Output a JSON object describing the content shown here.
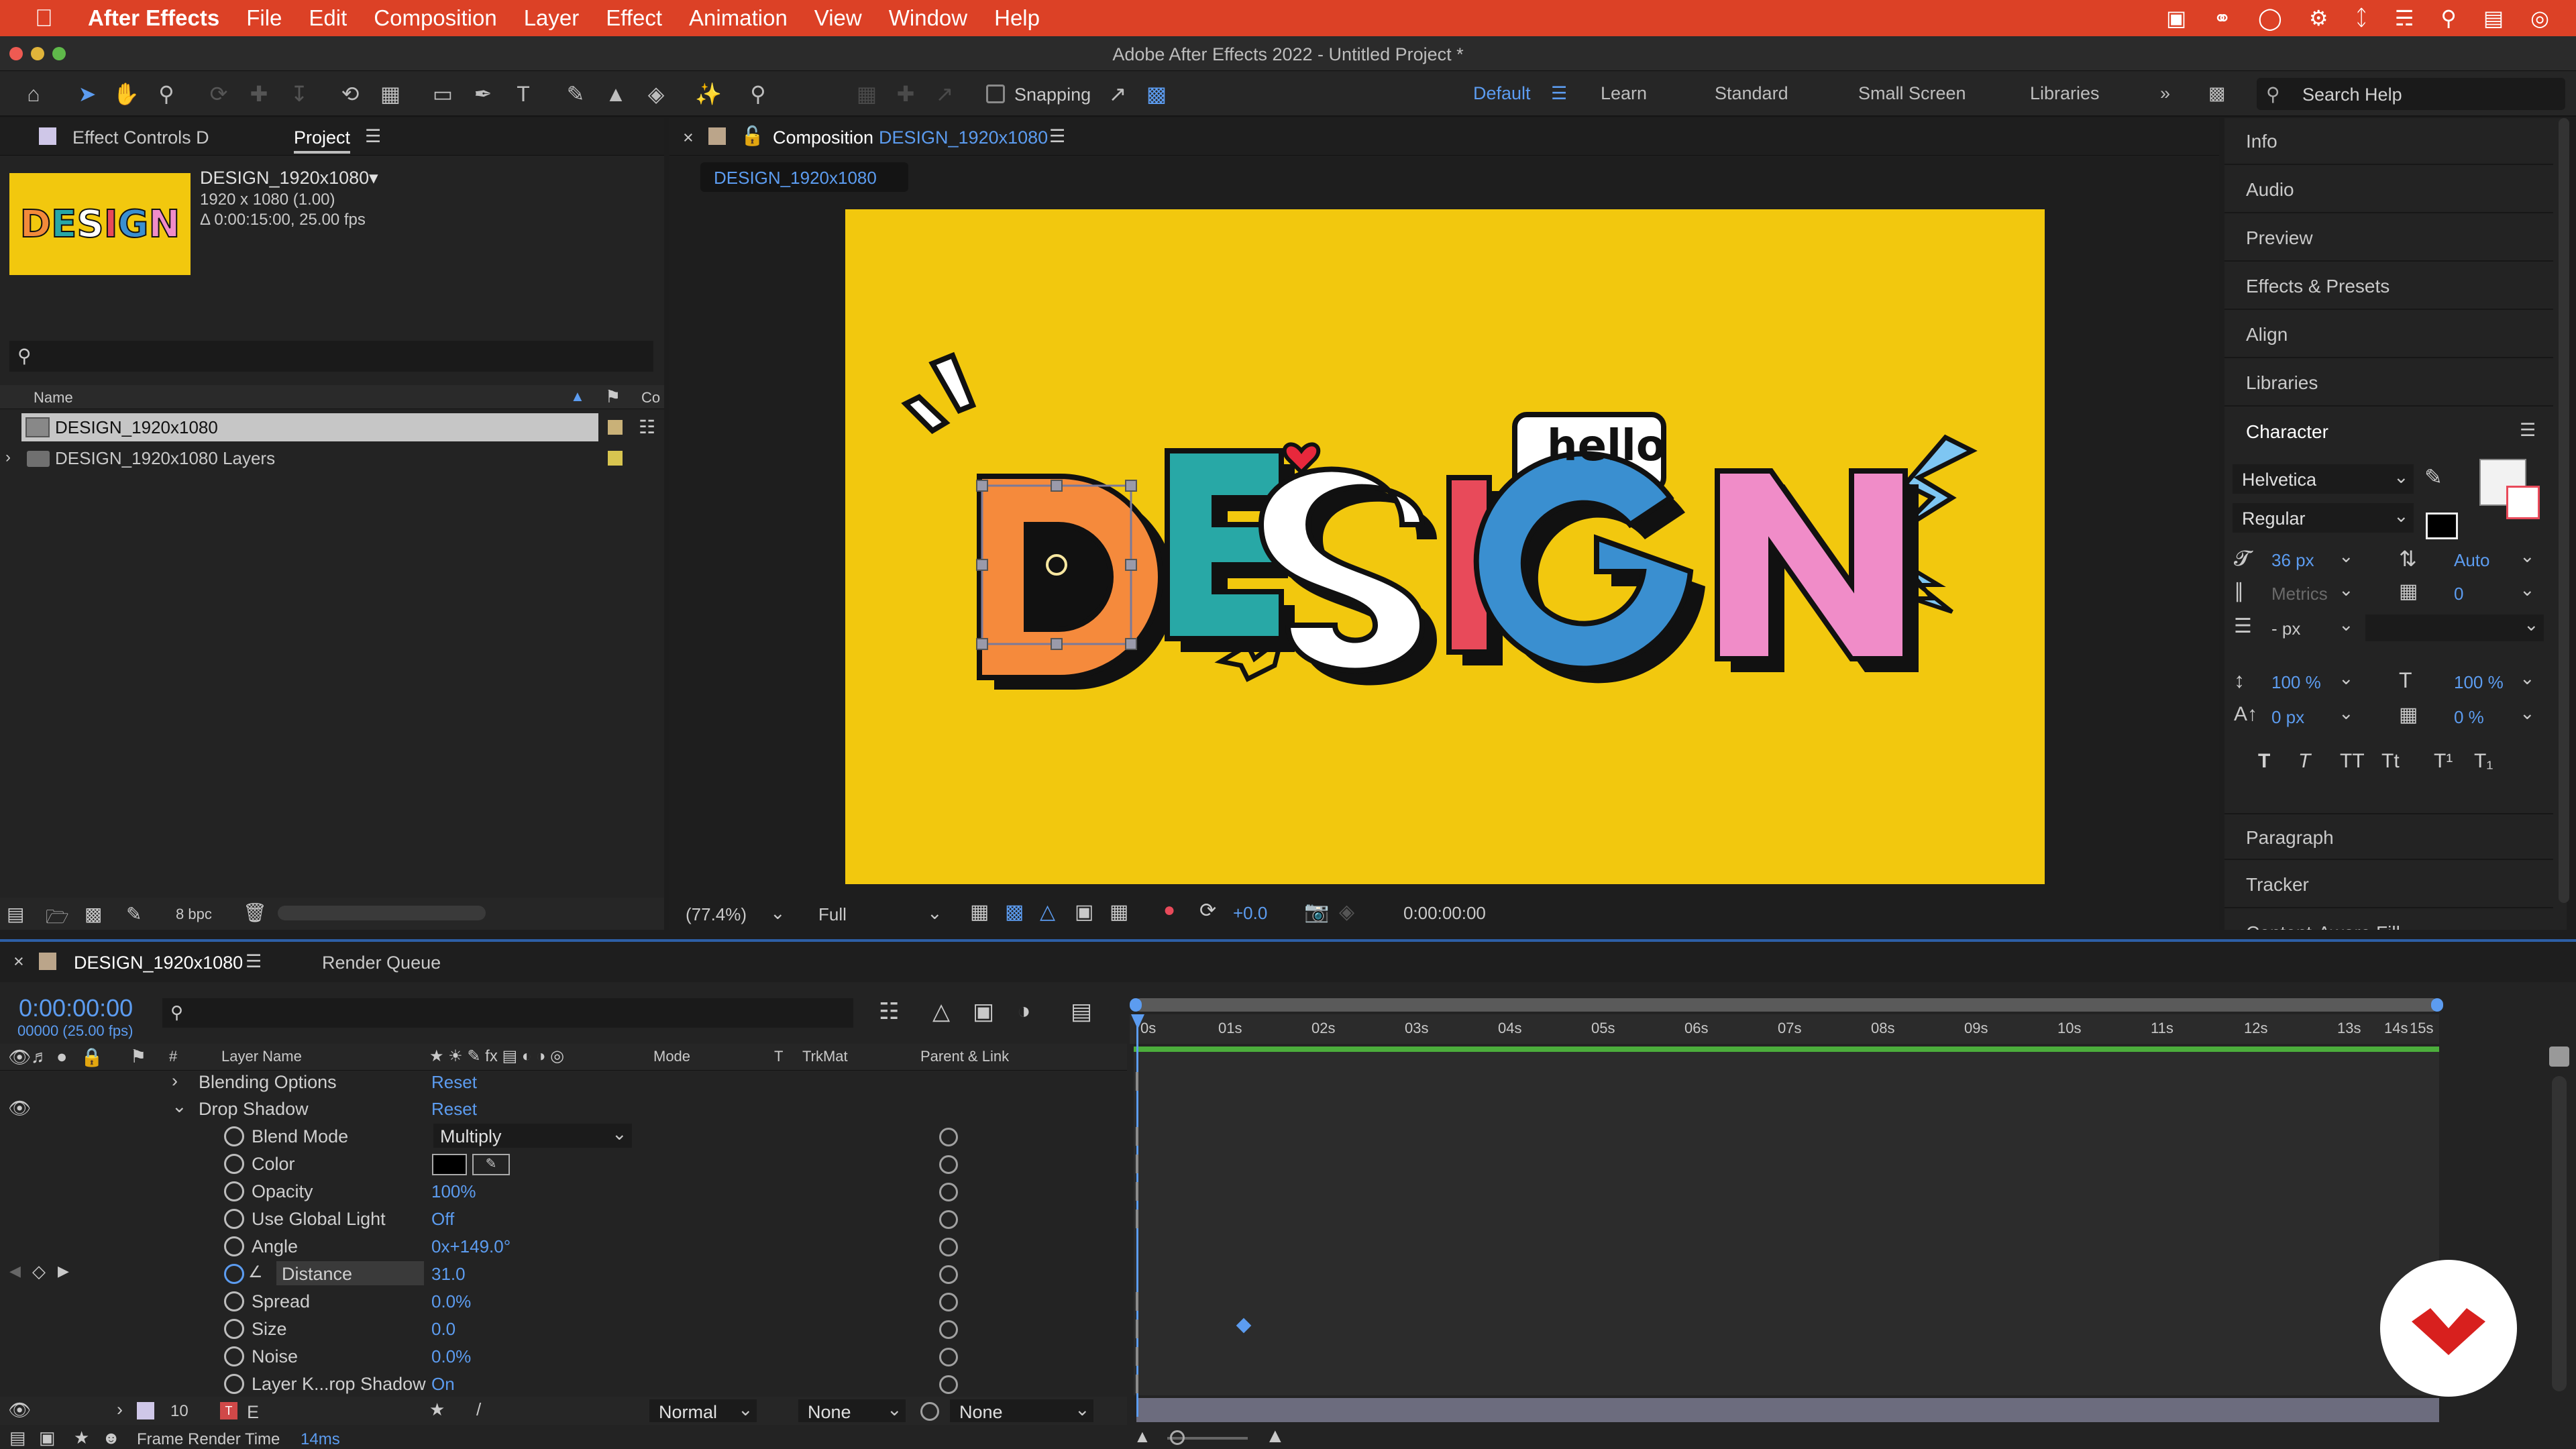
{
  "menubar": {
    "app": "After Effects",
    "items": [
      "File",
      "Edit",
      "Composition",
      "Layer",
      "Effect",
      "Animation",
      "View",
      "Window",
      "Help"
    ]
  },
  "window_title": "Adobe After Effects 2022 - Untitled Project *",
  "toolbar": {
    "snapping": "Snapping",
    "workspaces": [
      "Default",
      "Learn",
      "Standard",
      "Small Screen",
      "Libraries"
    ],
    "search_placeholder": "Search Help"
  },
  "project_panel": {
    "tab_effect_controls": "Effect Controls D",
    "tab_project": "Project",
    "comp_name": "DESIGN_1920x1080▾",
    "comp_res": "1920 x 1080 (1.00)",
    "comp_dur": "Δ 0:00:15:00, 25.00 fps",
    "col_name": "Name",
    "col_comment": "Co",
    "items": [
      {
        "name": "DESIGN_1920x1080",
        "selected": true
      },
      {
        "name": "DESIGN_1920x1080 Layers",
        "selected": false
      }
    ],
    "bpc": "8 bpc"
  },
  "comp_panel": {
    "tab_prefix": "Composition",
    "tab_name": "DESIGN_1920x1080",
    "sub_tab": "DESIGN_1920x1080",
    "artwork": {
      "hello": "hello",
      "letters": [
        "D",
        "E",
        "S",
        "I",
        "G",
        "N"
      ]
    },
    "zoom": "(77.4%)",
    "resolution": "Full",
    "exposure": "+0.0",
    "timecode": "0:00:00:00",
    "bg_color": "#f2c80e"
  },
  "right_panel": {
    "items": [
      "Info",
      "Audio",
      "Preview",
      "Effects & Presets",
      "Align",
      "Libraries"
    ],
    "character": {
      "title": "Character",
      "font": "Helvetica",
      "style": "Regular",
      "size": "36 px",
      "leading": "Auto",
      "kerning": "Metrics",
      "tracking": "0",
      "stroke": "- px",
      "vscale": "100 %",
      "hscale": "100 %",
      "baseline": "0 px",
      "tsume": "0 %",
      "styles": [
        "T",
        "T",
        "TT",
        "Tt",
        "T¹",
        "T₁"
      ]
    },
    "after_items": [
      "Paragraph",
      "Tracker",
      "Content-Aware Fill"
    ]
  },
  "timeline": {
    "tab": "DESIGN_1920x1080",
    "tab_render": "Render Queue",
    "timecode": "0:00:00:00",
    "frame_info": "00000 (25.00 fps)",
    "headers": {
      "hash": "#",
      "layer_name": "Layer Name",
      "mode": "Mode",
      "t": "T",
      "trkmat": "TrkMat",
      "parent": "Parent & Link"
    },
    "ruler": [
      "0s",
      "01s",
      "02s",
      "03s",
      "04s",
      "05s",
      "06s",
      "07s",
      "08s",
      "09s",
      "10s",
      "11s",
      "12s",
      "13s",
      "14s",
      "15s"
    ],
    "rows": [
      {
        "name": "Blending Options",
        "value": "Reset"
      },
      {
        "name": "Drop Shadow",
        "value": "Reset"
      },
      {
        "name": "Blend Mode",
        "value": "Multiply"
      },
      {
        "name": "Color",
        "value": ""
      },
      {
        "name": "Opacity",
        "value": "100%"
      },
      {
        "name": "Use Global Light",
        "value": "Off"
      },
      {
        "name": "Angle",
        "value": "0x+149.0°"
      },
      {
        "name": "Distance",
        "value": "31.0"
      },
      {
        "name": "Spread",
        "value": "0.0%"
      },
      {
        "name": "Size",
        "value": "0.0"
      },
      {
        "name": "Noise",
        "value": "0.0%"
      },
      {
        "name": "Layer K...rop Shadow",
        "value": "On"
      }
    ],
    "layer": {
      "num": "10",
      "name": "E",
      "mode": "Normal",
      "trkmat": "None",
      "parent": "None"
    },
    "frame_render_label": "Frame Render Time",
    "frame_render_value": "14ms"
  },
  "colors": {
    "accent": "#5c9cf0",
    "menubar": "#dc4126",
    "label_yellow": "#d8c550"
  }
}
